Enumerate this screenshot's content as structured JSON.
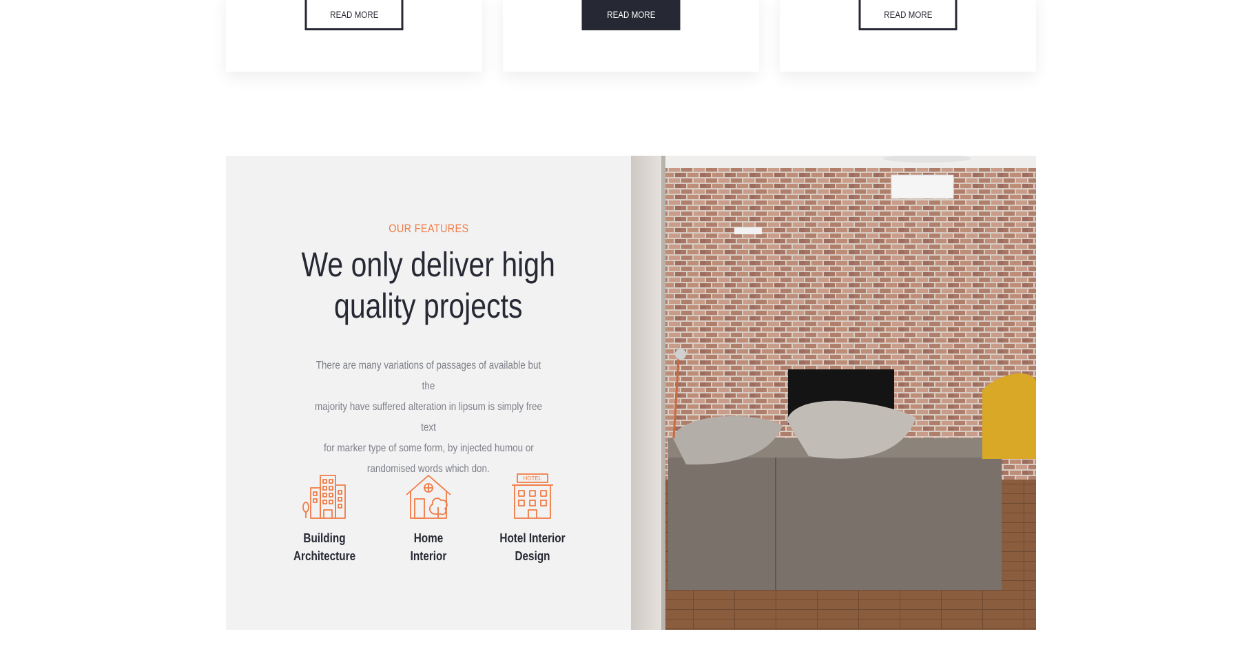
{
  "cards": [
    {
      "button_label": "READ MORE",
      "active": false
    },
    {
      "button_label": "READ MORE",
      "active": true
    },
    {
      "button_label": "READ MORE",
      "active": false
    }
  ],
  "features": {
    "tagline": "OUR FEATURES",
    "headline_line1": "We only deliver high",
    "headline_line2": "quality projects",
    "description": [
      "There are many variations of passages of available but the",
      "majority have suffered alteration in lipsum is simply free text",
      "for marker type of some form, by injected humou or",
      "randomised words which don."
    ],
    "items": [
      {
        "icon": "building-icon",
        "label_line1": "Building",
        "label_line2": "Architecture"
      },
      {
        "icon": "home-icon",
        "label_line1": "Home",
        "label_line2": "Interior"
      },
      {
        "icon": "hotel-icon",
        "label_line1": "Hotel Interior",
        "label_line2": "Design",
        "sign_text": "HOTEL"
      }
    ]
  },
  "colors": {
    "accent": "#f07b45",
    "dark": "#262833",
    "panel_bg": "#f2f2f2",
    "muted_text": "#7d7f88"
  }
}
